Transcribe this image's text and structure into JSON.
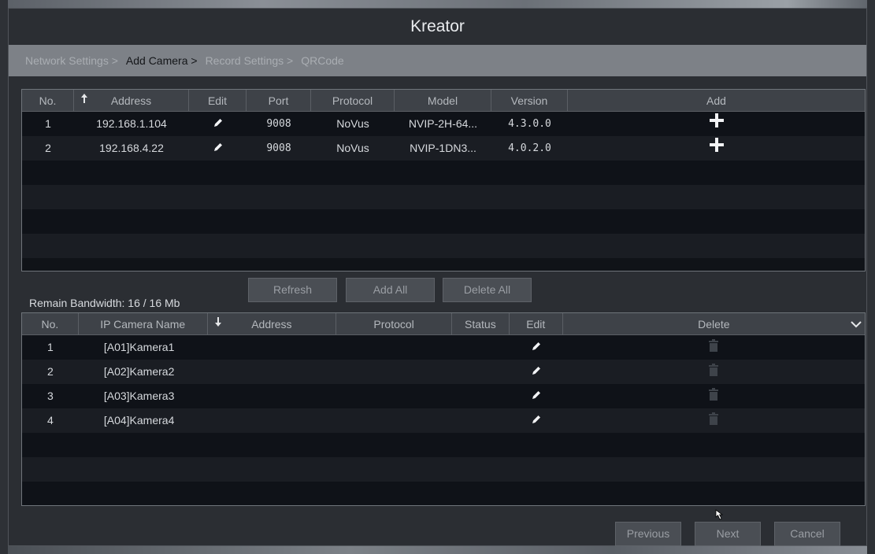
{
  "title": "Kreator",
  "steps": [
    {
      "label": "Network Settings >",
      "active": false
    },
    {
      "label": "Add Camera >",
      "active": true
    },
    {
      "label": "Record Settings >",
      "active": false
    },
    {
      "label": "QRCode",
      "active": false
    }
  ],
  "search_table": {
    "columns": [
      "No.",
      "Address",
      "Edit",
      "Port",
      "Protocol",
      "Model",
      "Version",
      "Add"
    ],
    "rows": [
      {
        "no": "1",
        "address": "192.168.1.104",
        "port": "9008",
        "protocol": "NoVus",
        "model": "NVIP-2H-64...",
        "version": "4.3.0.0"
      },
      {
        "no": "2",
        "address": "192.168.4.22",
        "port": "9008",
        "protocol": "NoVus",
        "model": "NVIP-1DN3...",
        "version": "4.0.2.0"
      }
    ]
  },
  "bandwidth": "Remain Bandwidth: 16 / 16 Mb",
  "buttons": {
    "refresh": "Refresh",
    "add_all": "Add All",
    "delete_all": "Delete All",
    "previous": "Previous",
    "next": "Next",
    "cancel": "Cancel"
  },
  "added_table": {
    "columns": [
      "No.",
      "IP Camera Name",
      "Address",
      "Protocol",
      "Status",
      "Edit",
      "Delete"
    ],
    "rows": [
      {
        "no": "1",
        "name": "[A01]Kamera1"
      },
      {
        "no": "2",
        "name": "[A02]Kamera2"
      },
      {
        "no": "3",
        "name": "[A03]Kamera3"
      },
      {
        "no": "4",
        "name": "[A04]Kamera4"
      }
    ]
  },
  "icons": {
    "sort_up": "arrow-up-icon",
    "sort_down": "arrow-down-icon",
    "edit": "pencil-icon",
    "add": "plus-icon",
    "delete": "trash-icon",
    "dropdown": "chevron-down-icon"
  },
  "colors": {
    "step_bar": "#7d8187",
    "active_step": "#141619",
    "table_bg": "#101318",
    "header_bg": "#3e4248"
  }
}
